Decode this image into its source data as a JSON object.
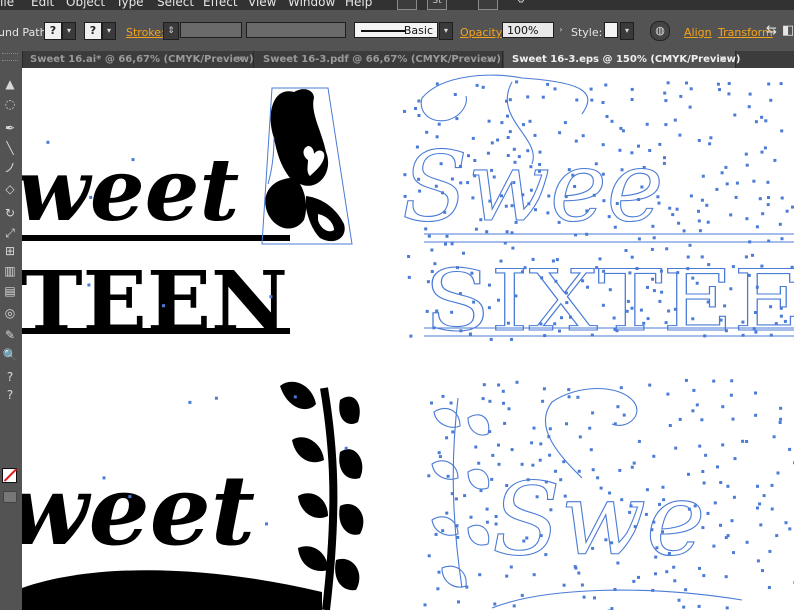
{
  "menubar": {
    "items": [
      "File",
      "Edit",
      "Object",
      "Type",
      "Select",
      "Effect",
      "View",
      "Window",
      "Help"
    ],
    "icon_st": "St"
  },
  "controlbar": {
    "left_label": "und Path",
    "q1": "?",
    "q2": "?",
    "stroke_label": "Stroke:",
    "brush_label": "Basic",
    "opacity_label": "Opacity:",
    "opacity_value": "100%",
    "style_label": "Style:",
    "align_label": "Align",
    "transform_label": "Transform",
    "accent_color": "#f6a31c"
  },
  "tabs": [
    {
      "label": "Sweet 16.ai* @ 66,67% (CMYK/Preview)",
      "close": "×",
      "active": false
    },
    {
      "label": "Sweet 16-3.pdf @ 66,67% (CMYK/Preview)",
      "close": "×",
      "active": false
    },
    {
      "label": "Sweet 16-3.eps @ 150% (CMYK/Preview)",
      "close": "×",
      "active": true
    }
  ],
  "tools": [
    "selection-icon",
    "lasso-icon",
    "pen-icon",
    "line-icon",
    "brush-icon",
    "eraser-icon",
    "rotate-icon",
    "scale-icon",
    "grid-icon",
    "graph-icon",
    "gradient-icon",
    "blend-icon",
    "eyedropper-icon",
    "zoom-icon",
    "hand-icon",
    "fill-stroke-icon"
  ],
  "tool_glyphs": [
    "▲",
    "◌",
    "✒",
    "╲",
    "ノ",
    "◇",
    "↻",
    "⤢",
    "⊞",
    "▥",
    "▤",
    "◎",
    "✎",
    "🔍",
    "?",
    "?"
  ],
  "artwork": {
    "solid_1_line1": "weet",
    "solid_1_line2": "TEEN",
    "outline_1_line1": "Swee",
    "outline_1_line2": "SIXTEE",
    "solid_2_line1": "weet",
    "outline_2_line1": "Swe",
    "outline_color": "#4a7bd6"
  }
}
